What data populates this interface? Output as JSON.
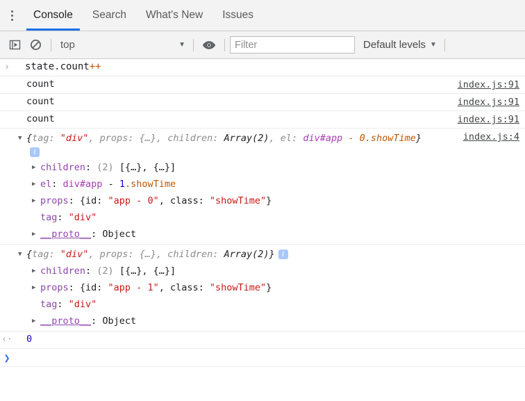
{
  "tabs": [
    {
      "label": "Console",
      "active": true
    },
    {
      "label": "Search",
      "active": false
    },
    {
      "label": "What's New",
      "active": false
    },
    {
      "label": "Issues",
      "active": false
    }
  ],
  "toolbar": {
    "sidebar_toggle_icon": "show-console-sidebar-icon",
    "clear_icon": "clear-console-icon",
    "context_value": "top",
    "context_caret": "▼",
    "eye_icon": "live-expression-eye-icon",
    "filter_placeholder": "Filter",
    "filter_value": "",
    "levels_label": "Default levels",
    "levels_caret": "▼"
  },
  "menu": {
    "kebab_icon": "more-options-icon"
  },
  "console": {
    "input_echo": {
      "prompt": "›",
      "text_plain": "state.count",
      "text_op": "++"
    },
    "log_rows": [
      {
        "message": "count",
        "source": "index.js:91"
      },
      {
        "message": "count",
        "source": "index.js:91"
      },
      {
        "message": "count",
        "source": "index.js:91"
      }
    ],
    "objects": [
      {
        "source": "index.js:4",
        "triangle": "▼",
        "preview": {
          "open_brace": "{",
          "key_tag": "tag: ",
          "val_tag": "\"div\"",
          "sep1": ", props: ",
          "val_props": "{…}",
          "sep2": ", children: ",
          "val_children": "Array(2)",
          "sep3": ", el: ",
          "val_node": "div#app",
          "val_node_suffix": " - 0.showTime",
          "close_brace": "}"
        },
        "info_badge": "i",
        "info_badge_below": true,
        "properties": [
          {
            "triangle": "▶",
            "name": "children",
            "value_parts": [
              {
                "text": ": ",
                "cls": "t-plain"
              },
              {
                "text": "(2)",
                "cls": "t-grey"
              },
              {
                "text": " [{…}, {…}]",
                "cls": "t-plain"
              }
            ]
          },
          {
            "triangle": "▶",
            "name": "el",
            "value_parts": [
              {
                "text": ": ",
                "cls": "t-plain"
              },
              {
                "text": "div#app",
                "cls": "t-node"
              },
              {
                "text": " - ",
                "cls": "t-plain"
              },
              {
                "text": "1",
                "cls": "t-num"
              },
              {
                "text": ".showTime",
                "cls": "t-orange"
              }
            ]
          },
          {
            "triangle": "▶",
            "name": "props",
            "value_parts": [
              {
                "text": ": {id: ",
                "cls": "t-plain"
              },
              {
                "text": "\"app - 0\"",
                "cls": "t-str"
              },
              {
                "text": ", class: ",
                "cls": "t-plain"
              },
              {
                "text": "\"showTime\"",
                "cls": "t-str"
              },
              {
                "text": "}",
                "cls": "t-plain"
              }
            ]
          },
          {
            "triangle": "",
            "name": "tag",
            "value_parts": [
              {
                "text": ": ",
                "cls": "t-plain"
              },
              {
                "text": "\"div\"",
                "cls": "t-str"
              }
            ]
          },
          {
            "triangle": "▶",
            "name": "__proto__",
            "is_proto": true,
            "value_parts": [
              {
                "text": ": Object",
                "cls": "t-plain"
              }
            ]
          }
        ]
      },
      {
        "source": "",
        "triangle": "▼",
        "preview": {
          "open_brace": "{",
          "key_tag": "tag: ",
          "val_tag": "\"div\"",
          "sep1": ", props: ",
          "val_props": "{…}",
          "sep2": ", children: ",
          "val_children": "Array(2)",
          "sep3": "",
          "val_node": "",
          "val_node_suffix": "",
          "close_brace": "}"
        },
        "info_badge": "i",
        "info_badge_below": false,
        "properties": [
          {
            "triangle": "▶",
            "name": "children",
            "value_parts": [
              {
                "text": ": ",
                "cls": "t-plain"
              },
              {
                "text": "(2)",
                "cls": "t-grey"
              },
              {
                "text": " [{…}, {…}]",
                "cls": "t-plain"
              }
            ]
          },
          {
            "triangle": "▶",
            "name": "props",
            "value_parts": [
              {
                "text": ": {id: ",
                "cls": "t-plain"
              },
              {
                "text": "\"app - 1\"",
                "cls": "t-str"
              },
              {
                "text": ", class: ",
                "cls": "t-plain"
              },
              {
                "text": "\"showTime\"",
                "cls": "t-str"
              },
              {
                "text": "}",
                "cls": "t-plain"
              }
            ]
          },
          {
            "triangle": "",
            "name": "tag",
            "value_parts": [
              {
                "text": ": ",
                "cls": "t-plain"
              },
              {
                "text": "\"div\"",
                "cls": "t-str"
              }
            ]
          },
          {
            "triangle": "▶",
            "name": "__proto__",
            "is_proto": true,
            "value_parts": [
              {
                "text": ": Object",
                "cls": "t-plain"
              }
            ]
          }
        ]
      }
    ],
    "result": {
      "arrow": "‹·",
      "value": "0"
    },
    "prompt": {
      "arrow": "❯",
      "value": ""
    }
  },
  "colors": {
    "accent": "#1a73e8",
    "string": "#c41a16",
    "number": "#1c00cf",
    "property": "#8e44ad",
    "node": "#a93ab5",
    "operator": "#c05600",
    "toolbar_bg": "#f3f3f3"
  }
}
